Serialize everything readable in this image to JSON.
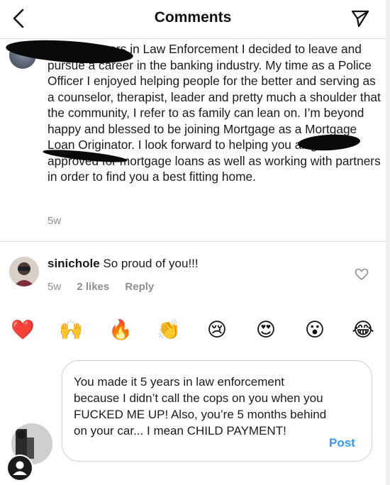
{
  "header": {
    "title": "Comments"
  },
  "caption": {
    "text": "3 After 5 years in Law Enforcement I decided to leave and pursue a career in the banking industry. My time as a Police Officer I enjoyed helping people for the better and serving as a counselor, therapist, leader and pretty much a shoulder that the community, I refer to as family can lean on. I’m beyond happy and blessed to be joining Mortgage as a Mortgage Loan Originator. I look forward to helping you all get approved for mortgage loans as well as working with partners in order to find you a best fitting home.",
    "time": "5w"
  },
  "comment": {
    "username": "sinichole",
    "text": " So proud of you!!!",
    "time": "5w",
    "likes": "2 likes",
    "reply_label": "Reply"
  },
  "emojis": [
    "❤️",
    "🙌",
    "🔥",
    "👏",
    "😢",
    "😍",
    "😮",
    "😂"
  ],
  "reply_input": {
    "value": "You made it 5 years in law enforcement because I didn’t call the cops on you when you FUCKED ME UP! Also, you’re 5 months behind on your car... I mean CHILD PAYMENT!",
    "post_label": "Post"
  },
  "colors": {
    "accent": "#3897f0",
    "secondary_text": "#8e8e8e",
    "divider": "#dbdbdb"
  },
  "icons": [
    "back-arrow-icon",
    "direct-share-icon",
    "heart-outline-icon",
    "user-silhouette-icon"
  ]
}
